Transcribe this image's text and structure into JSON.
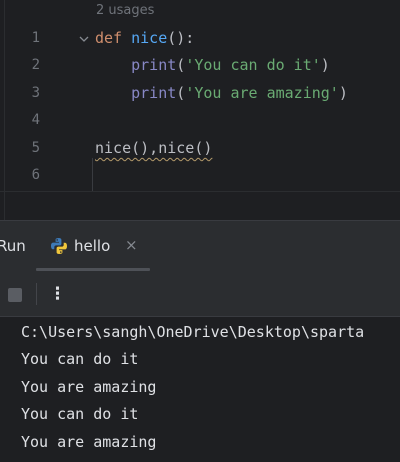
{
  "editor": {
    "usages_hint": "2 usages",
    "line_numbers": [
      "1",
      "2",
      "3",
      "4",
      "5",
      "6"
    ],
    "line1": {
      "keyword": "def",
      "space": " ",
      "func_name": "nice",
      "punct": "():"
    },
    "line2": {
      "indent": "    ",
      "builtin": "print",
      "open": "(",
      "string": "'You can do it'",
      "close": ")"
    },
    "line3": {
      "indent": "    ",
      "builtin": "print",
      "open": "(",
      "string": "'You are amazing'",
      "close": ")"
    },
    "line5": {
      "text": "nice(),nice()"
    }
  },
  "run_panel": {
    "run_label": "Run",
    "tab": {
      "label": "hello",
      "icon": "python-icon",
      "close_glyph": "×"
    },
    "toolbar": {
      "stop_icon": "stop-icon",
      "more_glyph": "⋮"
    },
    "console_lines": [
      "C:\\Users\\sangh\\OneDrive\\Desktop\\sparta",
      "You can do it",
      "You are amazing",
      "You can do it",
      "You are amazing"
    ]
  },
  "colors": {
    "background": "#1e1f22",
    "panel": "#2b2d30",
    "keyword": "#cf8e6d",
    "function": "#56a8f5",
    "builtin": "#8888c6",
    "string": "#6aab73",
    "text": "#bcbec4",
    "line_number": "#6f737a"
  }
}
